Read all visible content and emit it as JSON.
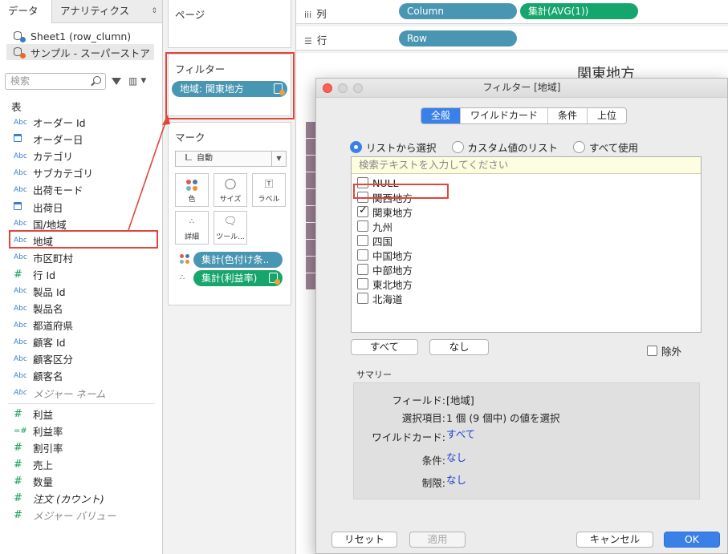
{
  "data_pane": {
    "tabs": [
      "データ",
      "アナリティクス"
    ],
    "tab_arrows": "⇕",
    "datasources": [
      "Sheet1 (row_clumn)",
      "サンプル - スーパーストア"
    ],
    "search_placeholder": "検索",
    "section_title": "表",
    "dimensions": [
      {
        "type": "Abc",
        "label": "オーダー Id"
      },
      {
        "type": "date",
        "label": "オーダー日"
      },
      {
        "type": "Abc",
        "label": "カテゴリ"
      },
      {
        "type": "Abc",
        "label": "サブカテゴリ"
      },
      {
        "type": "Abc",
        "label": "出荷モード"
      },
      {
        "type": "date",
        "label": "出荷日"
      },
      {
        "type": "Abc",
        "label": "国/地域"
      },
      {
        "type": "Abc",
        "label": "地域"
      },
      {
        "type": "Abc",
        "label": "市区町村"
      },
      {
        "type": "#",
        "label": "行 Id"
      },
      {
        "type": "Abc",
        "label": "製品 Id"
      },
      {
        "type": "Abc",
        "label": "製品名"
      },
      {
        "type": "Abc",
        "label": "都道府県"
      },
      {
        "type": "Abc",
        "label": "顧客 Id"
      },
      {
        "type": "Abc",
        "label": "顧客区分"
      },
      {
        "type": "Abc",
        "label": "顧客名"
      },
      {
        "type": "Abc",
        "label": "メジャー ネーム"
      }
    ],
    "measures": [
      {
        "type": "#",
        "label": "利益"
      },
      {
        "type": "=#",
        "label": "利益率"
      },
      {
        "type": "#",
        "label": "割引率"
      },
      {
        "type": "#",
        "label": "売上"
      },
      {
        "type": "#",
        "label": "数量"
      },
      {
        "type": "#",
        "label": "注文 (カウント)"
      },
      {
        "type": "#",
        "label": "メジャー バリュー"
      }
    ]
  },
  "shelves": {
    "pages_title": "ページ",
    "filters_title": "フィルター",
    "filter_pill": "地域: 関東地方",
    "marks_title": "マーク",
    "marks_type": "自動",
    "mark_buttons": [
      "色",
      "サイズ",
      "ラベル",
      "詳細",
      "ツール..."
    ],
    "mark_pills": [
      "集計(色付け条..",
      "集計(利益率)"
    ],
    "columns_label": "列",
    "rows_label": "行",
    "column_pills": [
      "Column",
      "集計(AVG(1))"
    ],
    "row_pills": [
      "Row"
    ]
  },
  "view": {
    "title": "関東地方"
  },
  "dialog": {
    "title": "フィルター [地域]",
    "tabs": [
      "全般",
      "ワイルドカード",
      "条件",
      "上位"
    ],
    "radios": [
      "リストから選択",
      "カスタム値のリスト",
      "すべて使用"
    ],
    "search_placeholder": "検索テキストを入力してください",
    "items": [
      {
        "label": "NULL",
        "checked": false
      },
      {
        "label": "関西地方",
        "checked": false
      },
      {
        "label": "関東地方",
        "checked": true
      },
      {
        "label": "九州",
        "checked": false
      },
      {
        "label": "四国",
        "checked": false
      },
      {
        "label": "中国地方",
        "checked": false
      },
      {
        "label": "中部地方",
        "checked": false
      },
      {
        "label": "東北地方",
        "checked": false
      },
      {
        "label": "北海道",
        "checked": false
      }
    ],
    "all_button": "すべて",
    "none_button": "なし",
    "exclude_label": "除外",
    "summary_title": "サマリー",
    "summary": {
      "field_k": "フィールド:",
      "field_v": "[地域]",
      "sel_k": "選択項目:",
      "sel_v": "1 個 (9 個中) の値を選択",
      "wild_k": "ワイルドカード:",
      "wild_v": "すべて",
      "cond_k": "条件:",
      "cond_v": "なし",
      "limit_k": "制限:",
      "limit_v": "なし"
    },
    "reset_button": "リセット",
    "apply_button": "適用",
    "cancel_button": "キャンセル",
    "ok_button": "OK"
  },
  "colors": {
    "highlight_red": "#e0463a",
    "dimension_pill": "#4996b2",
    "measure_pill": "#16a56d",
    "accent_blue": "#3a80e8"
  }
}
